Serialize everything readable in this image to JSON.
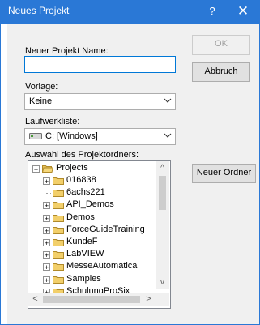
{
  "window": {
    "title": "Neues Projekt",
    "help_glyph": "?",
    "close_glyph": "✕"
  },
  "form": {
    "project_name_label": "Neuer Projekt Name:",
    "project_name_value": "",
    "template_label": "Vorlage:",
    "template_value": "Keine",
    "drive_label": "Laufwerkliste:",
    "drive_value": "C: [Windows]",
    "folder_label": "Auswahl des Projektordners:"
  },
  "buttons": {
    "ok": "OK",
    "cancel": "Abbruch",
    "new_folder": "Neuer Ordner"
  },
  "tree": {
    "root": "Projects",
    "items": [
      {
        "label": "016838",
        "expandable": true
      },
      {
        "label": "6achs221",
        "expandable": false
      },
      {
        "label": "API_Demos",
        "expandable": true
      },
      {
        "label": "Demos",
        "expandable": true
      },
      {
        "label": "ForceGuideTraining",
        "expandable": true
      },
      {
        "label": "KundeF",
        "expandable": true
      },
      {
        "label": "LabVIEW",
        "expandable": true
      },
      {
        "label": "MesseAutomatica",
        "expandable": true
      },
      {
        "label": "Samples",
        "expandable": true
      },
      {
        "label": "SchulungProSix",
        "expandable": true
      }
    ]
  },
  "scroll": {
    "up": "^",
    "down": "v",
    "left": "<",
    "right": ">"
  }
}
